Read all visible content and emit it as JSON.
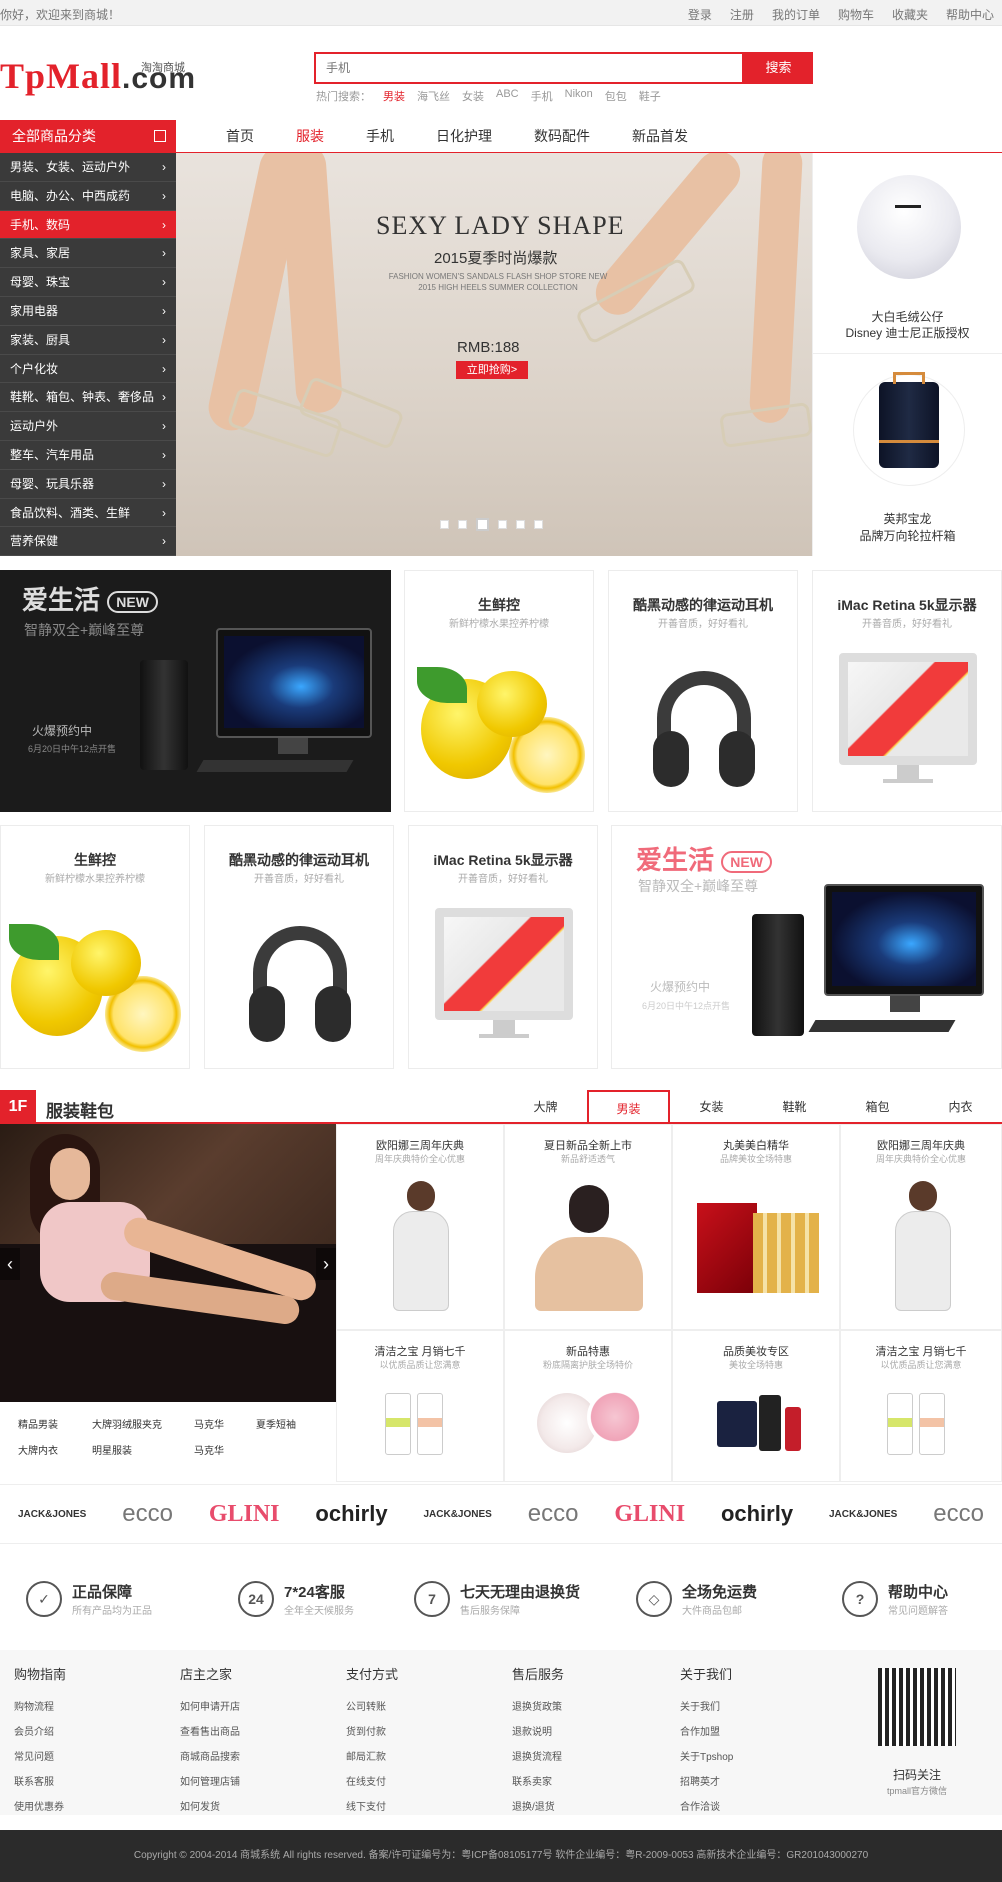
{
  "topbar": {
    "welcome": "你好，欢迎来到商城！",
    "links": [
      "登录",
      "注册",
      "我的订单",
      "购物车",
      "收藏夹",
      "帮助中心"
    ]
  },
  "header": {
    "logo_main": "TpMall",
    "logo_com": ".com",
    "logo_sub": "淘淘商城",
    "search_placeholder": "手机",
    "search_button": "搜索",
    "hot_label": "热门搜索：",
    "hot_words": [
      "男装",
      "海飞丝",
      "女装",
      "ABC",
      "手机",
      "Nikon",
      "包包",
      "鞋子"
    ]
  },
  "nav": {
    "category_title": "全部商品分类",
    "items": [
      "首页",
      "服装",
      "手机",
      "日化护理",
      "数码配件",
      "新品首发"
    ],
    "active": 1
  },
  "sidebar": {
    "items": [
      "男装、女装、运动户外",
      "电脑、办公、中西成药",
      "手机、数码",
      "家具、家居",
      "母婴、珠宝",
      "家用电器",
      "家装、厨具",
      "个户化妆",
      "鞋靴、箱包、钟表、奢侈品",
      "运动户外",
      "整车、汽车用品",
      "母婴、玩具乐器",
      "食品饮料、酒类、生鲜",
      "营养保健"
    ],
    "active": 2
  },
  "banner": {
    "title": "SEXY LADY SHAPE",
    "subtitle": "2015夏季时尚爆款",
    "small": "FASHION WOMEN'S SANDALS FLASH SHOP STORE NEW 2015 HIGH HEELS SUMMER COLLECTION",
    "price": "RMB:188",
    "button": "立即抢购>",
    "slides": 6,
    "active_slide": 2
  },
  "right_promo": [
    {
      "name": "大白毛绒公仔",
      "desc": "Disney 迪士尼正版授权"
    },
    {
      "name": "英邦宝龙",
      "desc": "品牌万向轮拉杆箱"
    }
  ],
  "row1": {
    "feature": {
      "title": "爱生活",
      "badge": "NEW",
      "sub": "智静双全+巅峰至尊",
      "hot": "火爆预约中",
      "date": "6月20日中午12点开售"
    },
    "tiles": [
      {
        "title": "生鲜控",
        "sub": "新鲜柠檬水果控养柠檬"
      },
      {
        "title": "酷黑动感的律运动耳机",
        "sub": "开善音质，好好看礼"
      },
      {
        "title": "iMac Retina 5k显示器",
        "sub": "开善音质，好好看礼"
      }
    ]
  },
  "row2": {
    "tiles": [
      {
        "title": "生鲜控",
        "sub": "新鲜柠檬水果控养柠檬"
      },
      {
        "title": "酷黑动感的律运动耳机",
        "sub": "开善音质，好好看礼"
      },
      {
        "title": "iMac Retina 5k显示器",
        "sub": "开善音质，好好看礼"
      }
    ],
    "feature": {
      "title": "爱生活",
      "badge": "NEW",
      "sub": "智静双全+巅峰至尊",
      "hot": "火爆预约中",
      "date": "6月20日中午12点开售"
    }
  },
  "floor": {
    "num": "1F",
    "title": "服装鞋包",
    "tabs": [
      "大牌",
      "男装",
      "女装",
      "鞋靴",
      "箱包",
      "内衣"
    ],
    "active_tab": 1,
    "links": [
      "精品男装",
      "大牌羽绒服夹克",
      "马克华",
      "夏季短袖",
      "大牌内衣",
      "明星服装",
      "马克华"
    ],
    "cells_top": [
      {
        "title": "欧阳娜三周年庆典",
        "sub": "周年庆典特价全心优惠"
      },
      {
        "title": "夏日新品全新上市",
        "sub": "新品舒适透气"
      },
      {
        "title": "丸美美白精华",
        "sub": "品牌美妆全场特惠"
      },
      {
        "title": "欧阳娜三周年庆典",
        "sub": "周年庆典特价全心优惠"
      }
    ],
    "cells_bottom": [
      {
        "title": "清洁之宝 月销七千",
        "sub": "以优质品质让您满意"
      },
      {
        "title": "新品特惠",
        "sub": "粉底隔离护肤全场特价"
      },
      {
        "title": "品质美妆专区",
        "sub": "美妆全场特惠"
      },
      {
        "title": "清洁之宝 月销七千",
        "sub": "以优质品质让您满意"
      }
    ]
  },
  "brands": [
    "JACK&JONES",
    "ecco",
    "GLINI",
    "ochirly",
    "JACK&JONES",
    "ecco",
    "GLINI",
    "ochirly",
    "JACK&JONES",
    "ecco"
  ],
  "service": [
    {
      "icon": "✓",
      "title": "正品保障",
      "sub": "所有产品均为正品"
    },
    {
      "icon": "24",
      "title": "7*24客服",
      "sub": "全年全天候服务"
    },
    {
      "icon": "7",
      "title": "七天无理由退换货",
      "sub": "售后服务保障"
    },
    {
      "icon": "◇",
      "title": "全场免运费",
      "sub": "大件商品包邮"
    },
    {
      "icon": "?",
      "title": "帮助中心",
      "sub": "常见问题解答"
    }
  ],
  "footer_cols": [
    {
      "head": "购物指南",
      "items": [
        "购物流程",
        "会员介绍",
        "常见问题",
        "联系客服",
        "使用优惠券"
      ]
    },
    {
      "head": "店主之家",
      "items": [
        "如何申请开店",
        "查看售出商品",
        "商城商品搜索",
        "如何管理店铺",
        "如何发货"
      ]
    },
    {
      "head": "支付方式",
      "items": [
        "公司转账",
        "货到付款",
        "邮局汇款",
        "在线支付",
        "线下支付"
      ]
    },
    {
      "head": "售后服务",
      "items": [
        "退换货政策",
        "退款说明",
        "退换货流程",
        "联系卖家",
        "退换/退货"
      ]
    },
    {
      "head": "关于我们",
      "items": [
        "关于我们",
        "合作加盟",
        "关于Tpshop",
        "招聘英才",
        "合作洽谈"
      ]
    }
  ],
  "qr": {
    "title": "扫码关注",
    "sub": "tpmall官方微信"
  },
  "copyright": "Copyright © 2004-2014 商城系统 All rights reserved.  备案/许可证编号为：粤ICP备08105177号   软件企业编号：粤R-2009-0053   高新技术企业编号：GR201043000270"
}
